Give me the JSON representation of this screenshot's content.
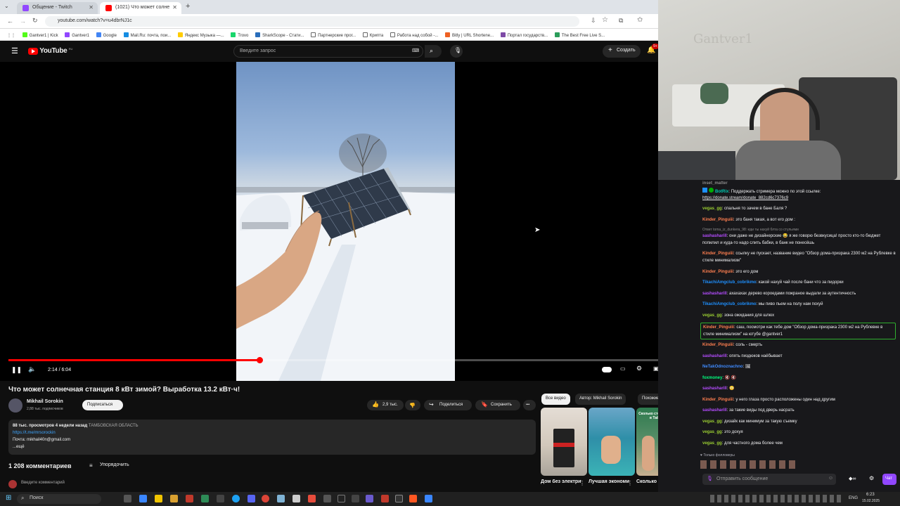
{
  "browser": {
    "tabs": [
      {
        "label": "Общение - Twitch",
        "color": "#9147ff"
      },
      {
        "label": "(1021) Что может солне",
        "color": "#ff0000"
      }
    ],
    "url": "youtube.com/watch?v=u4dbrNJ1c",
    "bookmarks": [
      {
        "label": "Gantver1 | Kick",
        "color": "#53fc18"
      },
      {
        "label": "Gantver1",
        "color": "#9147ff"
      },
      {
        "label": "Google",
        "color": "#4285f4"
      },
      {
        "label": "Mail.Ru: почта, пои...",
        "color": "#168de2"
      },
      {
        "label": "Яндекс Музыка —...",
        "color": "#ffcc00"
      },
      {
        "label": "Trovo",
        "color": "#19d66b"
      },
      {
        "label": "SharkScope - Стати...",
        "color": "#2a6ebb"
      },
      {
        "label": "Партнерские прог...",
        "color": "#888"
      },
      {
        "label": "Крипта",
        "color": "#888"
      },
      {
        "label": "Работа над собой -...",
        "color": "#888"
      },
      {
        "label": "Bitly | URL Shortene...",
        "color": "#ee6123"
      },
      {
        "label": "Портал государств...",
        "color": "#7d4aa6"
      },
      {
        "label": "The Best Free Live S...",
        "color": "#2b9d5a"
      }
    ]
  },
  "youtube": {
    "logo_text": "YouTube",
    "logo_badge": "RU",
    "search_placeholder": "Введите запрос",
    "create_label": "Создать",
    "notif_count": "9+",
    "video": {
      "time": "2:14 / 6:04",
      "progress": 0.373,
      "title": "Что может солнечная станция 8 кВт зимой? Выработка 13.2 кВт·ч!",
      "channel": "Mikhail Sorokin",
      "subscribers": "2,88 тыс. подписчиков",
      "subscribe_label": "Подписаться",
      "likes": "2,9 тыс.",
      "share_label": "Поделиться",
      "save_label": "Сохранить",
      "more_label": "•••",
      "desc_stats": "88 тыс. просмотров  4 недели назад",
      "desc_tag": "ТАМБОВСКАЯ ОБЛАСТЬ",
      "desc_link": "https://t.me/mrsorockin",
      "desc_mail": "Почта: mikhail40n@gmail.com",
      "desc_more": "...ещё"
    },
    "comments_count": "1 208 комментариев",
    "sort_label": "Упорядочить",
    "add_comment": "Введите комментарий",
    "chips": [
      "Все видео",
      "Автор: Mikhail Sorokin",
      "Похожие"
    ],
    "related": [
      {
        "title": "Дом без электриче"
      },
      {
        "title": "Лучшая экономия"
      },
      {
        "title": "Сколько стоит"
      }
    ],
    "thumb3_text": "Сколько стоит квартира в Тайланде"
  },
  "webcam": {
    "wall_text": "Gantver1"
  },
  "chat": {
    "messages": [
      {
        "user": "inset_matter",
        "color": "#8a8a8a",
        "text": ""
      },
      {
        "user": "BotRix",
        "color": "#00c8af",
        "text": "Поддержать стримера можно по этой ссылке:"
      },
      {
        "user": "",
        "color": "#efeff1",
        "text": "https://donate.stream/donate_882cd6c7376c9"
      },
      {
        "user": "vegas_gg",
        "color": "#9acd32",
        "text": "спальня то зачем в бане Баля ?"
      },
      {
        "user": "Kinder_Pinguiii",
        "color": "#ff7f50",
        "text": "это баня такая, а вот его дом :"
      },
      {
        "user": "",
        "color": "#8a8a8a",
        "text": "Ответ toma_iz_dunkera_98: иди ты нахуй блта со стульями"
      },
      {
        "user": "sashasharill",
        "color": "#b54dff",
        "text": "они даже не дизайнерские 😂 я же говорю безвкусица! просто кто-то бюджет попилил и куда-то надо слить бабки, в банк не понесёшь"
      },
      {
        "user": "Kinder_Pinguiii",
        "color": "#ff7f50",
        "text": "ссылку не пускает, название видео \"Обзор дома-призрака 2300 м2 на Рублевке в стиле минимализм\""
      },
      {
        "user": "Kinder_Pinguiii",
        "color": "#ff7f50",
        "text": "это его дом"
      },
      {
        "user": "TikachiAmgclub_cobrikmo",
        "color": "#1e90ff",
        "text": "какой нахуй чай после бани что за пидорки"
      },
      {
        "user": "sashasharill",
        "color": "#b54dff",
        "text": "ахахахах дерево короедами пожраное выдали за аутентичность"
      },
      {
        "user": "TikachiAmgclub_cobrikmo",
        "color": "#1e90ff",
        "text": "мы пиво пьем на полу нам похуй"
      },
      {
        "user": "vegas_gg",
        "color": "#9acd32",
        "text": "зона ожидания для шлюх"
      },
      {
        "user": "Kinder_Pinguiii",
        "color": "#ff7f50",
        "text": "саш, посмотри как тебе дом \"Обзор дома-призрака 2300 м2 на Рублевке в стиле минимализм\" на ютубе @gantver1"
      },
      {
        "user": "Kinder_Pinguiii",
        "color": "#ff7f50",
        "text": "соль - смерть"
      },
      {
        "user": "sashasharill",
        "color": "#b54dff",
        "text": "опять пиздюков наёбывает"
      },
      {
        "user": "NeTakOdnoznachno",
        "color": "#3f8bff",
        "text": "🖼"
      },
      {
        "user": "foxmoney",
        "color": "#00ff7f",
        "text": "🔇 🔇"
      },
      {
        "user": "sashasharill",
        "color": "#b54dff",
        "text": "😳"
      },
      {
        "user": "Kinder_Pinguiii",
        "color": "#ff7f50",
        "text": "у него глаза просто расположены один над другим"
      },
      {
        "user": "sashasharill",
        "color": "#b54dff",
        "text": "за такие виды под дверь насрать"
      },
      {
        "user": "vegas_gg",
        "color": "#9acd32",
        "text": "дизайк как минимум за такую съемку"
      },
      {
        "user": "vegas_gg",
        "color": "#9acd32",
        "text": "это дохуя"
      },
      {
        "user": "vegas_gg",
        "color": "#9acd32",
        "text": "для частного дома более чем"
      }
    ],
    "followers_only": "Только фолловеры",
    "input_placeholder": "Отправить сообщение",
    "send_label": "Чат"
  },
  "taskbar": {
    "search_label": "Поиск",
    "lang": "ENG",
    "time": "6:23",
    "date": "15.02.2025"
  }
}
